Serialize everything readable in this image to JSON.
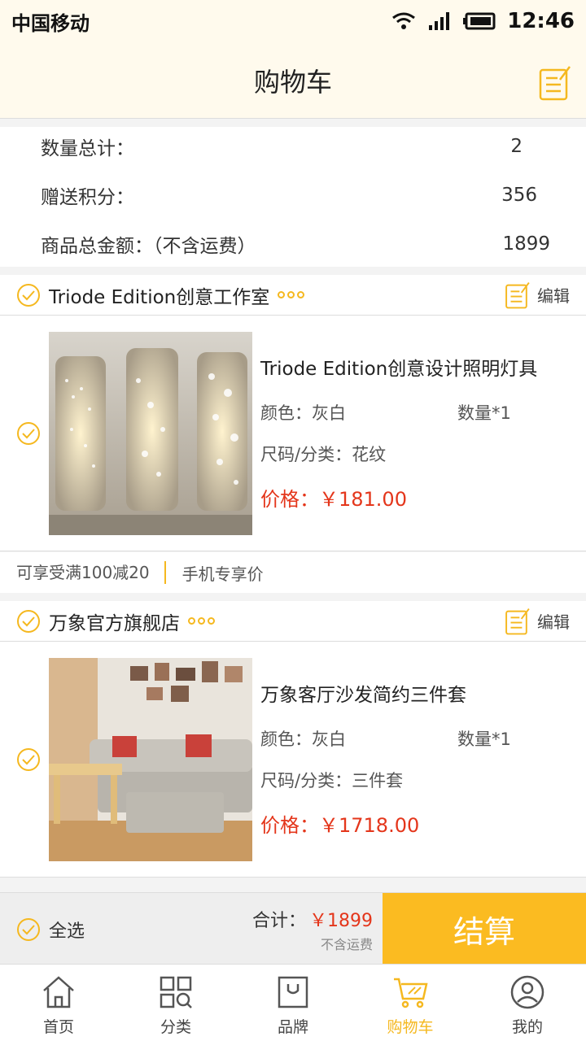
{
  "status_bar": {
    "carrier": "中国移动",
    "time": "12:46"
  },
  "header": {
    "title": "购物车"
  },
  "summary": {
    "rows": [
      {
        "label": "数量总计：",
        "value": "2"
      },
      {
        "label": "赠送积分：",
        "value": "356"
      },
      {
        "label": "商品总金额：（不含运费）",
        "value": "1899"
      }
    ]
  },
  "stores": [
    {
      "name": "Triode Edition创意工作室",
      "edit_label": "编辑",
      "product": {
        "name": "Triode Edition创意设计照明灯具",
        "color": "颜色：灰白",
        "qty": "数量*1",
        "size": "尺码/分类：花纹",
        "price": "价格：￥181.00"
      },
      "promo": {
        "discount": "可享受满100减20",
        "mobile": "手机专享价"
      }
    },
    {
      "name": "万象官方旗舰店",
      "edit_label": "编辑",
      "product": {
        "name": "万象客厅沙发简约三件套",
        "color": "颜色：灰白",
        "qty": "数量*1",
        "size": "尺码/分类：三件套",
        "price": "价格：￥1718.00"
      }
    }
  ],
  "checkout": {
    "select_all": "全选",
    "total_label": "合计：",
    "total_amount": "￥1899",
    "shipping_note": "不含运费",
    "button": "结算"
  },
  "tabs": [
    {
      "label": "首页",
      "icon": "home-icon"
    },
    {
      "label": "分类",
      "icon": "category-icon"
    },
    {
      "label": "品牌",
      "icon": "brand-bag-icon"
    },
    {
      "label": "购物车",
      "icon": "cart-icon",
      "active": true
    },
    {
      "label": "我的",
      "icon": "profile-icon"
    }
  ],
  "colors": {
    "accent": "#f5b81f",
    "price": "#e4361b",
    "header_bg": "#fffaed",
    "checkout_button": "#fbbb21"
  }
}
